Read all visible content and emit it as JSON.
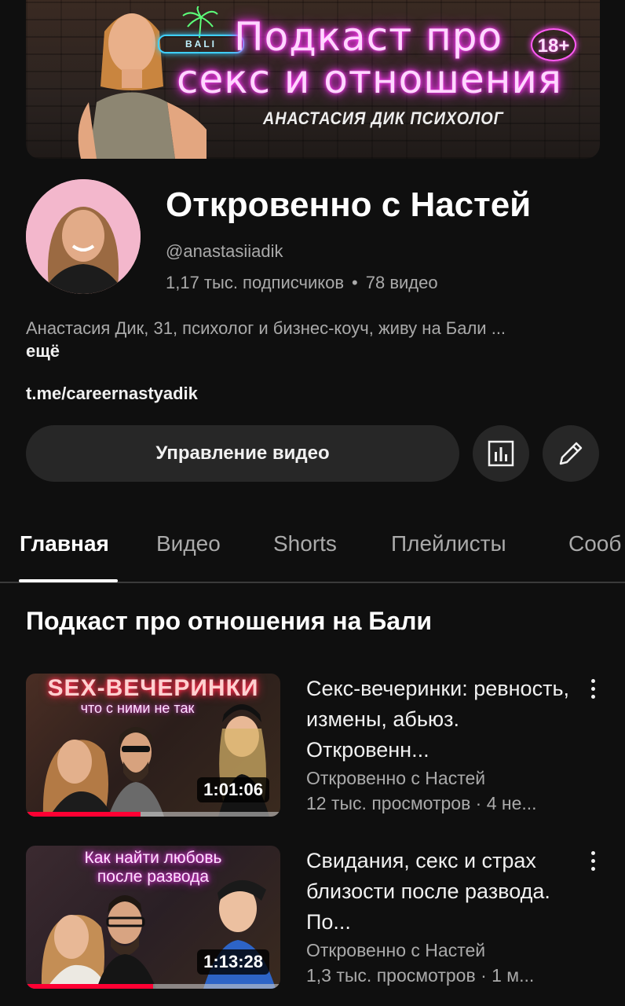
{
  "banner": {
    "bali_sign": "BALI",
    "title_line1": "Подкаст про",
    "title_line2": "секс и отношения",
    "age_badge": "18+",
    "subtitle": "АНАСТАСИЯ ДИК ПСИХОЛОГ"
  },
  "channel": {
    "name": "Откровенно с Настей",
    "handle": "@anastasiiadik",
    "subscribers": "1,17 тыс. подписчиков",
    "stats_separator": "•",
    "videos_count": "78 видео",
    "description": "Анастасия Дик, 31, психолог и бизнес-коуч, живу на Бали ...",
    "more_label": "ещё",
    "link": "t.me/careernastyadik"
  },
  "actions": {
    "manage_videos_label": "Управление видео",
    "stats_icon": "bar-chart-icon",
    "edit_icon": "pencil-icon"
  },
  "tabs": [
    {
      "label": "Главная",
      "active": true
    },
    {
      "label": "Видео",
      "active": false
    },
    {
      "label": "Shorts",
      "active": false
    },
    {
      "label": "Плейлисты",
      "active": false
    },
    {
      "label": "Сооб",
      "active": false
    }
  ],
  "section": {
    "title": "Подкаст про отношения на Бали"
  },
  "videos": [
    {
      "thumb_heading": "SEX-ВЕЧЕРИНКИ",
      "thumb_subheading": "что с ними не так",
      "duration": "1:01:06",
      "progress": 0.45,
      "title": "Секс-вечеринки: ревность, измены, абьюз. Откровенн...",
      "channel": "Откровенно с Настей",
      "meta": "12 тыс. просмотров · 4 не..."
    },
    {
      "thumb_heading": "Как найти любовь",
      "thumb_subheading": "после развода",
      "duration": "1:13:28",
      "progress": 0.5,
      "title": "Свидания, секс и страх близости после развода. По...",
      "channel": "Откровенно с Настей",
      "meta": "1,3 тыс. просмотров · 1 м..."
    }
  ],
  "colors": {
    "background": "#0f0f0f",
    "button_bg": "#272727",
    "secondary_text": "#aaaaaa",
    "neon_pink": "#ff3df5",
    "progress_red": "#ff0033"
  }
}
